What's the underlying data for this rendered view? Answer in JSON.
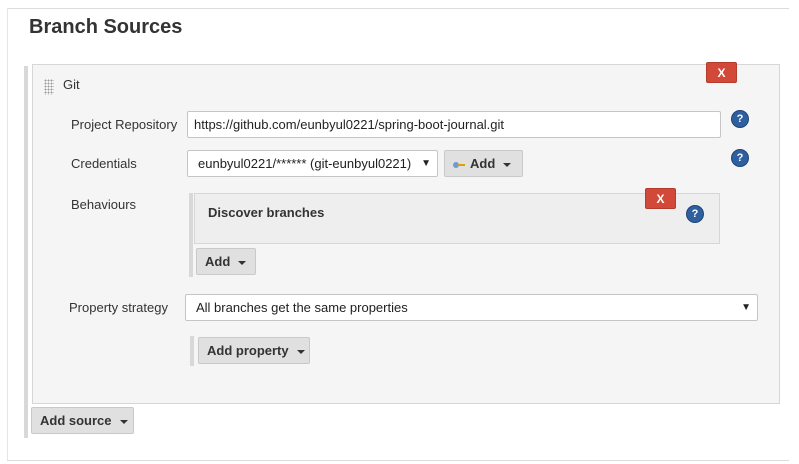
{
  "section": {
    "title": "Branch Sources"
  },
  "source": {
    "name": "Git",
    "delete_label": "X",
    "project_repository": {
      "label": "Project Repository",
      "value": "https://github.com/eunbyul0221/spring-boot-journal.git"
    },
    "credentials": {
      "label": "Credentials",
      "selected": "eunbyul0221/****** (git-eunbyul0221)",
      "add_label": "Add"
    },
    "behaviours": {
      "label": "Behaviours",
      "items": [
        {
          "title": "Discover branches",
          "delete_label": "X"
        }
      ],
      "add_label": "Add"
    },
    "property_strategy": {
      "label": "Property strategy",
      "selected": "All branches get the same properties",
      "add_property_label": "Add property"
    }
  },
  "add_source_label": "Add source",
  "icons": {
    "help": "help-icon",
    "caret": "caret-down-icon",
    "key": "key-icon",
    "drag": "drag-handle-icon"
  },
  "colors": {
    "delete": "#d24939",
    "help": "#2f5f9e",
    "panel": "#f5f5f5",
    "button": "#e0e0e0"
  }
}
